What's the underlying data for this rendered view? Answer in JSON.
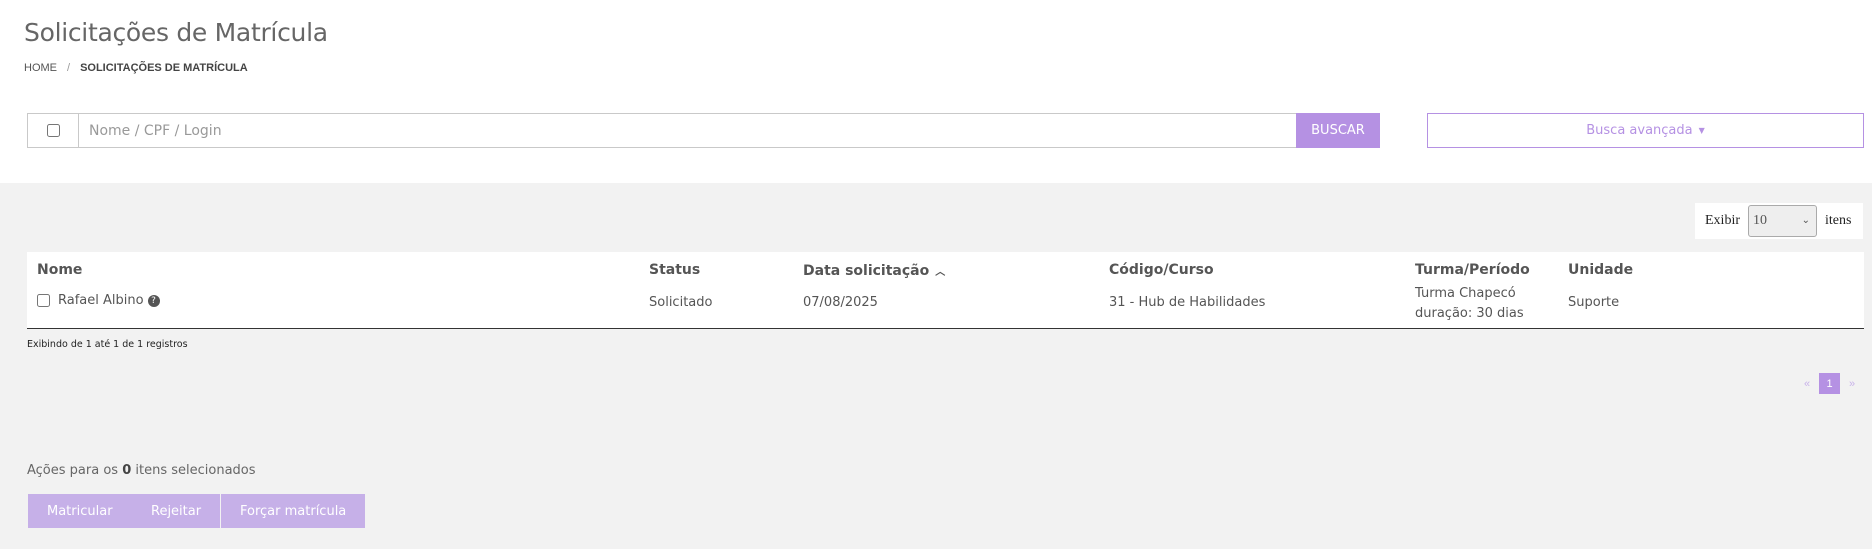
{
  "page": {
    "title": "Solicitações de Matrícula",
    "breadcrumb": {
      "home": "HOME",
      "separator": "/",
      "current": "SOLICITAÇÕES DE MATRÍCULA"
    }
  },
  "search": {
    "placeholder": "Nome / CPF / Login",
    "value": "",
    "button_label": "BUSCAR",
    "advanced_label": "Busca avançada",
    "icon": "search-icon"
  },
  "pager": {
    "show_label": "Exibir",
    "page_size": "10",
    "items_label": "itens",
    "current_page": "1",
    "prev_icon": "«",
    "next_icon": "»"
  },
  "table": {
    "columns": {
      "name": "Nome",
      "status": "Status",
      "date": "Data solicitação",
      "course": "Código/Curso",
      "class": "Turma/Período",
      "unit": "Unidade"
    },
    "sort": {
      "column": "date",
      "direction": "asc"
    },
    "rows": [
      {
        "name": "Rafael Albino",
        "status": "Solicitado",
        "date": "07/08/2025",
        "course": "31 - Hub de Habilidades",
        "class_line1": "Turma Chapecó",
        "class_line2": "duração: 30 dias",
        "unit": "Suporte"
      }
    ]
  },
  "records_info": "Exibindo de 1 até 1 de 1 registros",
  "actions": {
    "prefix": "Ações para os",
    "count": "0",
    "suffix": "itens selecionados",
    "buttons": {
      "enroll": "Matricular",
      "reject": "Rejeitar",
      "force": "Forçar matrícula"
    }
  },
  "colors": {
    "accent": "#b591e3",
    "accent_disabled": "#c6b0e8",
    "background": "#f2f2f2"
  }
}
